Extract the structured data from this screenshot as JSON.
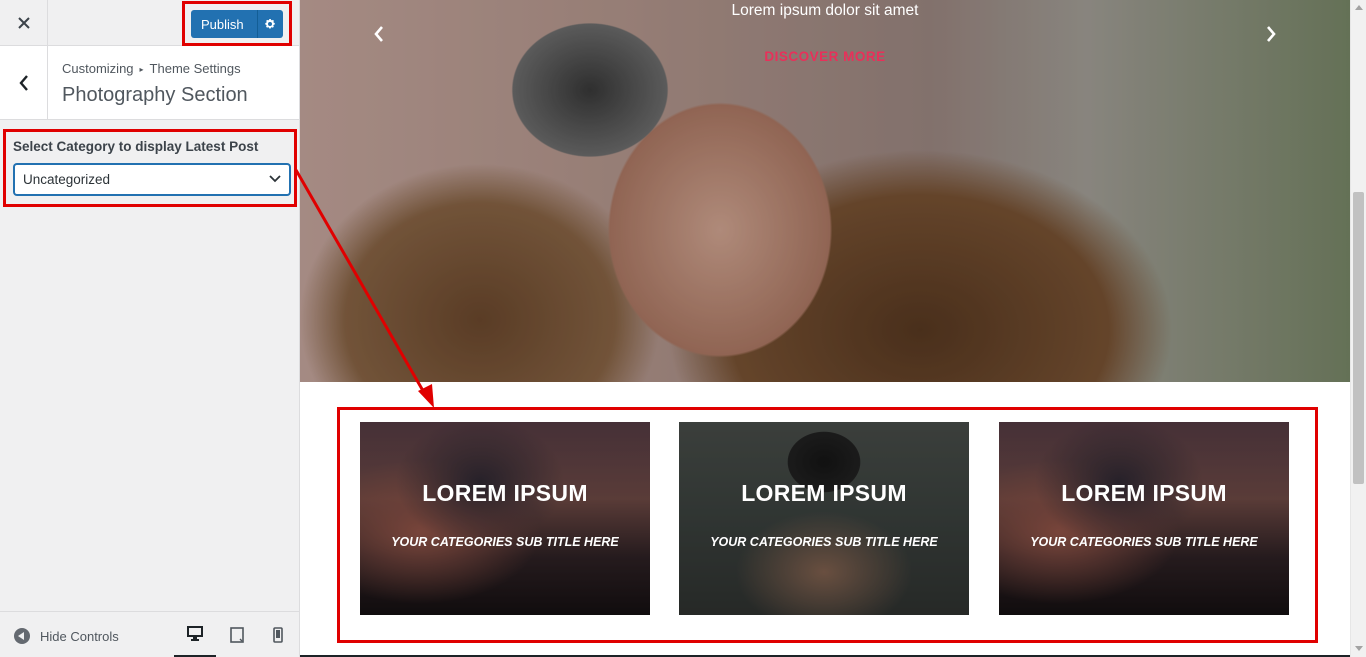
{
  "header": {
    "close_icon": "close-icon",
    "publish_label": "Publish",
    "publish_settings_icon": "gear-icon"
  },
  "section": {
    "breadcrumb_root": "Customizing",
    "breadcrumb_separator": "▸",
    "breadcrumb_parent": "Theme Settings",
    "title": "Photography Section"
  },
  "control": {
    "label": "Select Category to display Latest Post",
    "selected_value": "Uncategorized"
  },
  "footer": {
    "hide_controls_label": "Hide Controls",
    "devices": [
      "desktop",
      "tablet",
      "mobile"
    ],
    "active_device": "desktop"
  },
  "preview": {
    "slider": {
      "caption": "Lorem ipsum dolor sit amet",
      "cta_label": "DISCOVER MORE"
    },
    "cards": [
      {
        "title": "LOREM IPSUM",
        "subtitle": "YOUR CATEGORIES SUB TITLE HERE"
      },
      {
        "title": "LOREM IPSUM",
        "subtitle": "YOUR CATEGORIES SUB TITLE HERE"
      },
      {
        "title": "LOREM IPSUM",
        "subtitle": "YOUR CATEGORIES SUB TITLE HERE"
      }
    ]
  },
  "colors": {
    "highlight": "#e00000",
    "publish_button": "#2271b1",
    "cta": "#e8305a"
  }
}
